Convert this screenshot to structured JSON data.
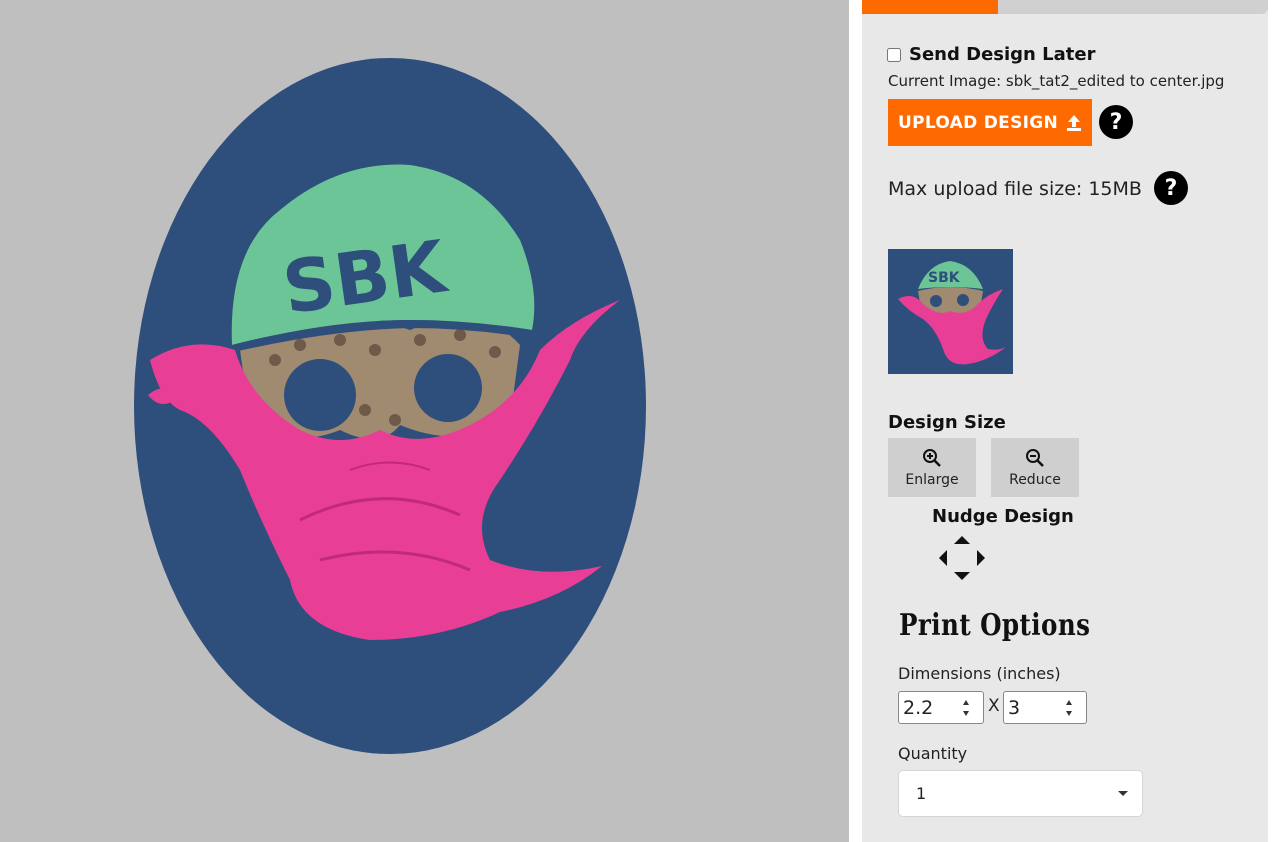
{
  "design_options": {
    "send_later_label": "Send Design Later",
    "send_later_checked": false,
    "current_image_label": "Current Image: sbk_tat2_edited to center.jpg",
    "upload_label": "UPLOAD DESIGN",
    "help_glyph": "?",
    "max_upload_label": "Max upload file size: 15MB"
  },
  "design_size": {
    "title": "Design Size",
    "enlarge_label": "Enlarge",
    "reduce_label": "Reduce"
  },
  "nudge": {
    "title": "Nudge Design"
  },
  "print_options": {
    "title": "Print Options",
    "dimensions_label": "Dimensions (inches)",
    "width_value": "2.2",
    "height_value": "3",
    "separator": "X",
    "quantity_label": "Quantity",
    "quantity_value": "1"
  },
  "artwork": {
    "logo_text": "SBK",
    "colors": {
      "background": "#2e4e7c",
      "helmet": "#6cc597",
      "mask": "#e83e96",
      "gears": "#a08a70",
      "accent": "#ff6a00"
    }
  }
}
